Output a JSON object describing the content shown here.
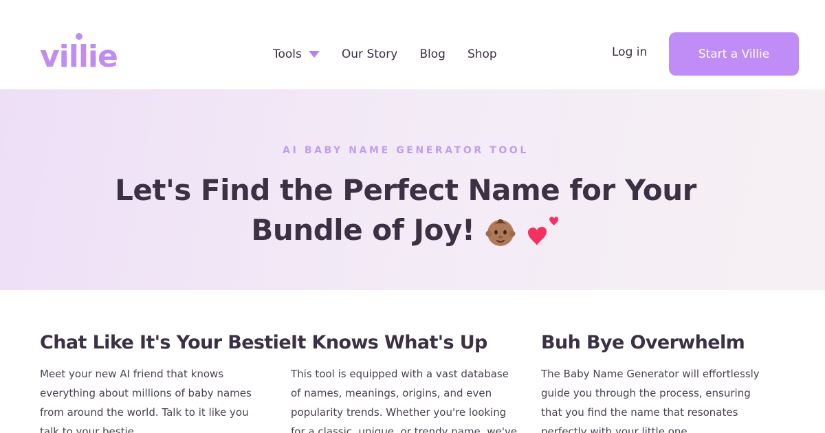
{
  "brand": {
    "name": "villie",
    "color": "#c08cf2"
  },
  "nav": {
    "items": [
      {
        "label": "Tools",
        "has_dropdown": true
      },
      {
        "label": "Our Story"
      },
      {
        "label": "Blog"
      },
      {
        "label": "Shop"
      }
    ],
    "login_label": "Log in",
    "cta_label": "Start a Villie"
  },
  "hero": {
    "eyebrow": "AI BABY NAME GENERATOR TOOL",
    "title_line1": "Let's Find the Perfect Name for Your",
    "title_line2": "Bundle of Joy!",
    "emojis": [
      "baby-face-icon",
      "two-hearts-icon"
    ]
  },
  "features": [
    {
      "title": "Chat Like It's Your Bestie",
      "body": "Meet your new AI friend that knows everything about millions of baby names from around the world. Talk to it like you talk to your bestie."
    },
    {
      "title": "It Knows What's Up",
      "body": "This tool is equipped with a vast database of names, meanings, origins, and even popularity trends. Whether you're looking for a classic, unique, or trendy name, we've"
    },
    {
      "title": "Buh Bye Overwhelm",
      "body": "The Baby Name Generator will effortlessly guide you through the process, ensuring that you find the name that resonates perfectly with your little one."
    }
  ],
  "colors": {
    "accent": "#c08cf6",
    "text_dark": "#3c3144",
    "eyebrow": "#c29cef",
    "hero_bg_start": "#eedff7",
    "hero_bg_end": "#f6f0f4"
  }
}
